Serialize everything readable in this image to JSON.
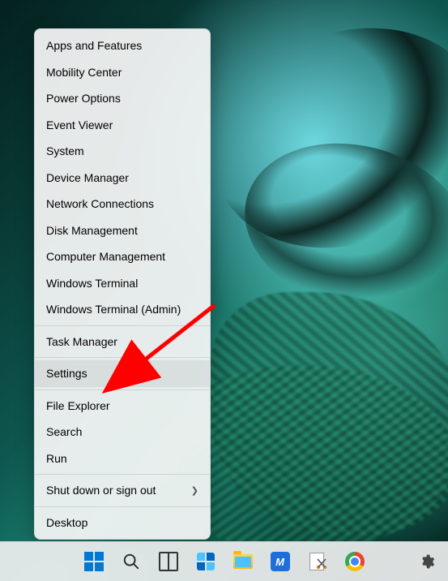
{
  "menu": {
    "items": [
      {
        "id": "apps-and-features",
        "label": "Apps and Features",
        "submenu": false
      },
      {
        "id": "mobility-center",
        "label": "Mobility Center",
        "submenu": false
      },
      {
        "id": "power-options",
        "label": "Power Options",
        "submenu": false
      },
      {
        "id": "event-viewer",
        "label": "Event Viewer",
        "submenu": false
      },
      {
        "id": "system",
        "label": "System",
        "submenu": false
      },
      {
        "id": "device-manager",
        "label": "Device Manager",
        "submenu": false
      },
      {
        "id": "network-connections",
        "label": "Network Connections",
        "submenu": false
      },
      {
        "id": "disk-management",
        "label": "Disk Management",
        "submenu": false
      },
      {
        "id": "computer-management",
        "label": "Computer Management",
        "submenu": false
      },
      {
        "id": "windows-terminal",
        "label": "Windows Terminal",
        "submenu": false
      },
      {
        "id": "windows-terminal-admin",
        "label": "Windows Terminal (Admin)",
        "submenu": false
      },
      {
        "sep": true
      },
      {
        "id": "task-manager",
        "label": "Task Manager",
        "submenu": false
      },
      {
        "sep": true
      },
      {
        "id": "settings",
        "label": "Settings",
        "submenu": false,
        "hover": true
      },
      {
        "sep": true
      },
      {
        "id": "file-explorer",
        "label": "File Explorer",
        "submenu": false
      },
      {
        "id": "search",
        "label": "Search",
        "submenu": false
      },
      {
        "id": "run",
        "label": "Run",
        "submenu": false
      },
      {
        "sep": true
      },
      {
        "id": "shut-down-or-sign-out",
        "label": "Shut down or sign out",
        "submenu": true
      },
      {
        "sep": true
      },
      {
        "id": "desktop",
        "label": "Desktop",
        "submenu": false
      }
    ]
  },
  "annotation": {
    "arrow_color": "#ff0000",
    "target": "settings"
  },
  "taskbar": {
    "items": [
      {
        "id": "start",
        "icon": "windows-logo-icon"
      },
      {
        "id": "search",
        "icon": "search-icon"
      },
      {
        "id": "task-view",
        "icon": "task-view-icon"
      },
      {
        "id": "widgets",
        "icon": "widgets-icon"
      },
      {
        "id": "file-explorer",
        "icon": "file-explorer-icon"
      },
      {
        "id": "app-m",
        "icon": "app-tile-icon",
        "letter": "M"
      },
      {
        "id": "snipping-tool",
        "icon": "snipping-tool-icon"
      },
      {
        "id": "chrome",
        "icon": "chrome-icon"
      }
    ],
    "tray": {
      "id": "settings-gear",
      "icon": "gear-icon"
    }
  }
}
